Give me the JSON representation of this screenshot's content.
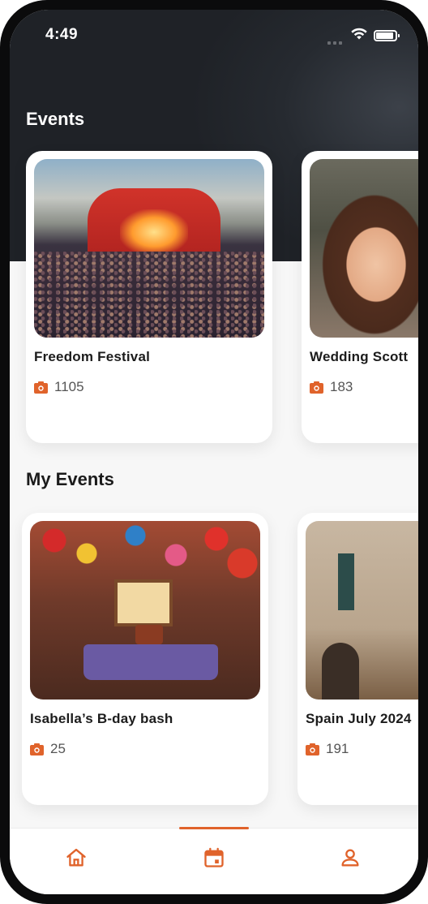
{
  "status_bar": {
    "time": "4:49"
  },
  "events": {
    "title": "Events",
    "cards": [
      {
        "name": "Freedom Festival",
        "count": "1105"
      },
      {
        "name": "Wedding Scott",
        "count": "183"
      }
    ]
  },
  "my_events": {
    "title": "My Events",
    "cards": [
      {
        "name": "Isabella’s B-day bash",
        "count": "25"
      },
      {
        "name": "Spain July 2024",
        "count": "191"
      }
    ]
  },
  "bottom_nav": {
    "items": [
      {
        "icon": "home-icon"
      },
      {
        "icon": "calendar-icon",
        "active": true
      },
      {
        "icon": "profile-icon"
      }
    ]
  },
  "colors": {
    "accent": "#e0632b",
    "hero_bg": "#23272d",
    "text_dark": "#1b1b1b"
  }
}
